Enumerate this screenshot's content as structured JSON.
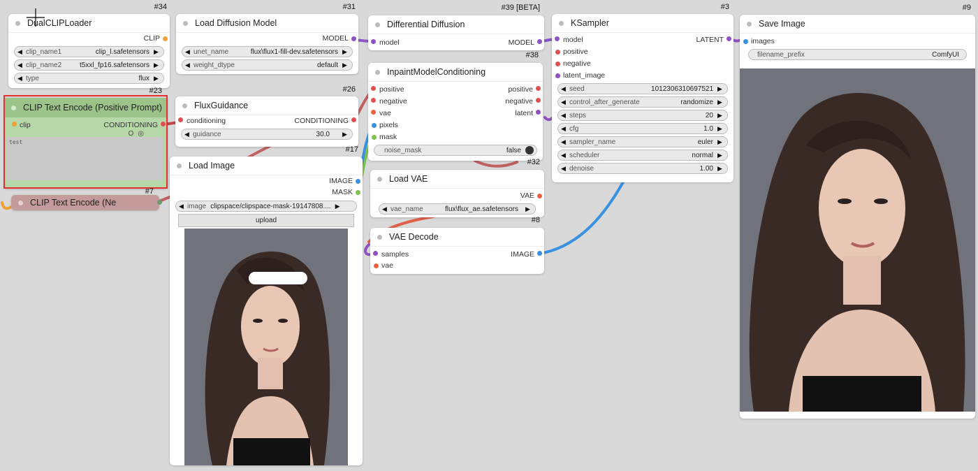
{
  "colors": {
    "canvas": "#d9d9d9",
    "selection": "#e53030",
    "clip": "#f0a035",
    "model": "#8a54c8",
    "conditioning": "#e05050",
    "latent": "#9050c0",
    "image": "#3a90e0",
    "mask": "#80c050",
    "vae": "#f06040"
  },
  "nodes": {
    "dualclip": {
      "id": "#34",
      "title": "DualCLIPLoader",
      "out_clip": "CLIP",
      "clip_name1_label": "clip_name1",
      "clip_name1_value": "clip_l.safetensors",
      "clip_name2_label": "clip_name2",
      "clip_name2_value": "t5xxl_fp16.safetensors",
      "type_label": "type",
      "type_value": "flux"
    },
    "clip_pos": {
      "id": "#23",
      "title": "CLIP Text Encode (Positive Prompt)",
      "in_clip": "clip",
      "out_cond": "CONDITIONING",
      "text": "test",
      "icon_a": "O",
      "icon_b": "◎"
    },
    "clip_neg": {
      "id": "#7",
      "title": "CLIP Text Encode (Ne"
    },
    "load_diffusion": {
      "id": "#31",
      "title": "Load Diffusion Model",
      "out_model": "MODEL",
      "unet_label": "unet_name",
      "unet_value": "flux\\flux1-fill-dev.safetensors",
      "dtype_label": "weight_dtype",
      "dtype_value": "default"
    },
    "flux_guidance": {
      "id": "#26",
      "title": "FluxGuidance",
      "in_cond": "conditioning",
      "out_cond": "CONDITIONING",
      "guidance_label": "guidance",
      "guidance_value": "30.0"
    },
    "load_image": {
      "id": "#17",
      "title": "Load Image",
      "out_image": "IMAGE",
      "out_mask": "MASK",
      "image_label": "image",
      "image_value": "clipspace/clipspace-mask-19147808....",
      "upload": "upload"
    },
    "diff_diffusion": {
      "id": "#39 [BETA]",
      "title": "Differential Diffusion",
      "in_model": "model",
      "out_model": "MODEL"
    },
    "inpaint": {
      "id": "#38",
      "title": "InpaintModelConditioning",
      "in_positive": "positive",
      "in_negative": "negative",
      "in_vae": "vae",
      "in_pixels": "pixels",
      "in_mask": "mask",
      "out_positive": "positive",
      "out_negative": "negative",
      "out_latent": "latent",
      "noise_mask_label": "noise_mask",
      "noise_mask_value": "false"
    },
    "load_vae": {
      "id": "#32",
      "title": "Load VAE",
      "out_vae": "VAE",
      "vae_label": "vae_name",
      "vae_value": "flux\\flux_ae.safetensors"
    },
    "vae_decode": {
      "id": "#8",
      "title": "VAE Decode",
      "in_samples": "samples",
      "in_vae": "vae",
      "out_image": "IMAGE"
    },
    "ksampler": {
      "id": "#3",
      "title": "KSampler",
      "in_model": "model",
      "in_positive": "positive",
      "in_negative": "negative",
      "in_latent": "latent_image",
      "out_latent": "LATENT",
      "seed_label": "seed",
      "seed_value": "1012306310697521",
      "cag_label": "control_after_generate",
      "cag_value": "randomize",
      "steps_label": "steps",
      "steps_value": "20",
      "cfg_label": "cfg",
      "cfg_value": "1.0",
      "sampler_label": "sampler_name",
      "sampler_value": "euler",
      "scheduler_label": "scheduler",
      "scheduler_value": "normal",
      "denoise_label": "denoise",
      "denoise_value": "1.00"
    },
    "save_image": {
      "id": "#9",
      "title": "Save Image",
      "in_images": "images",
      "prefix_label": "filename_prefix",
      "prefix_value": "ComfyUI"
    }
  }
}
